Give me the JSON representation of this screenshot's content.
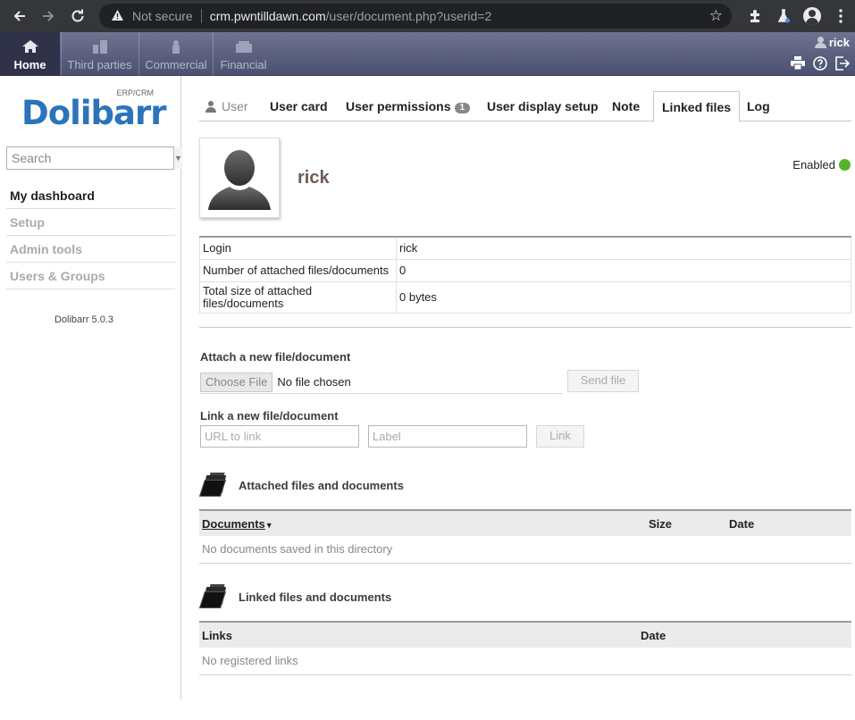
{
  "browser": {
    "security_label": "Not secure",
    "url_host": "crm.pwntilldawn.com",
    "url_path": "/user/document.php?userid=2"
  },
  "topmenu": {
    "items": [
      {
        "label": "Home",
        "icon": "home-icon"
      },
      {
        "label": "Third parties",
        "icon": "building-icon"
      },
      {
        "label": "Commercial",
        "icon": "commercial-icon"
      },
      {
        "label": "Financial",
        "icon": "financial-icon"
      }
    ],
    "username": "rick"
  },
  "sidebar": {
    "logo_text": "Dolibarr",
    "logo_sub": "ERP/CRM",
    "search_placeholder": "Search",
    "items": [
      {
        "label": "My dashboard"
      },
      {
        "label": "Setup"
      },
      {
        "label": "Admin tools"
      },
      {
        "label": "Users & Groups"
      }
    ],
    "version": "Dolibarr 5.0.3"
  },
  "tabs": {
    "user": "User",
    "user_card": "User card",
    "user_permissions": "User permissions",
    "permissions_badge": "1",
    "user_display_setup": "User display setup",
    "note": "Note",
    "linked_files": "Linked files",
    "log": "Log"
  },
  "profile": {
    "username": "rick",
    "status": "Enabled",
    "status_color": "#55b22a"
  },
  "info": {
    "login_label": "Login",
    "login_value": "rick",
    "num_files_label": "Number of attached files/documents",
    "num_files_value": "0",
    "total_size_label": "Total size of attached files/documents",
    "total_size_value": "0 bytes"
  },
  "attach": {
    "title": "Attach a new file/document",
    "choose_file": "Choose File",
    "no_file": "No file chosen",
    "send_file": "Send file"
  },
  "link_new": {
    "title": "Link a new file/document",
    "url_placeholder": "URL to link",
    "label_placeholder": "Label",
    "link_button": "Link"
  },
  "attached_section": {
    "title": "Attached files and documents",
    "col_documents": "Documents",
    "col_size": "Size",
    "col_date": "Date",
    "empty": "No documents saved in this directory"
  },
  "linked_section": {
    "title": "Linked files and documents",
    "col_links": "Links",
    "col_date": "Date",
    "empty": "No registered links"
  }
}
